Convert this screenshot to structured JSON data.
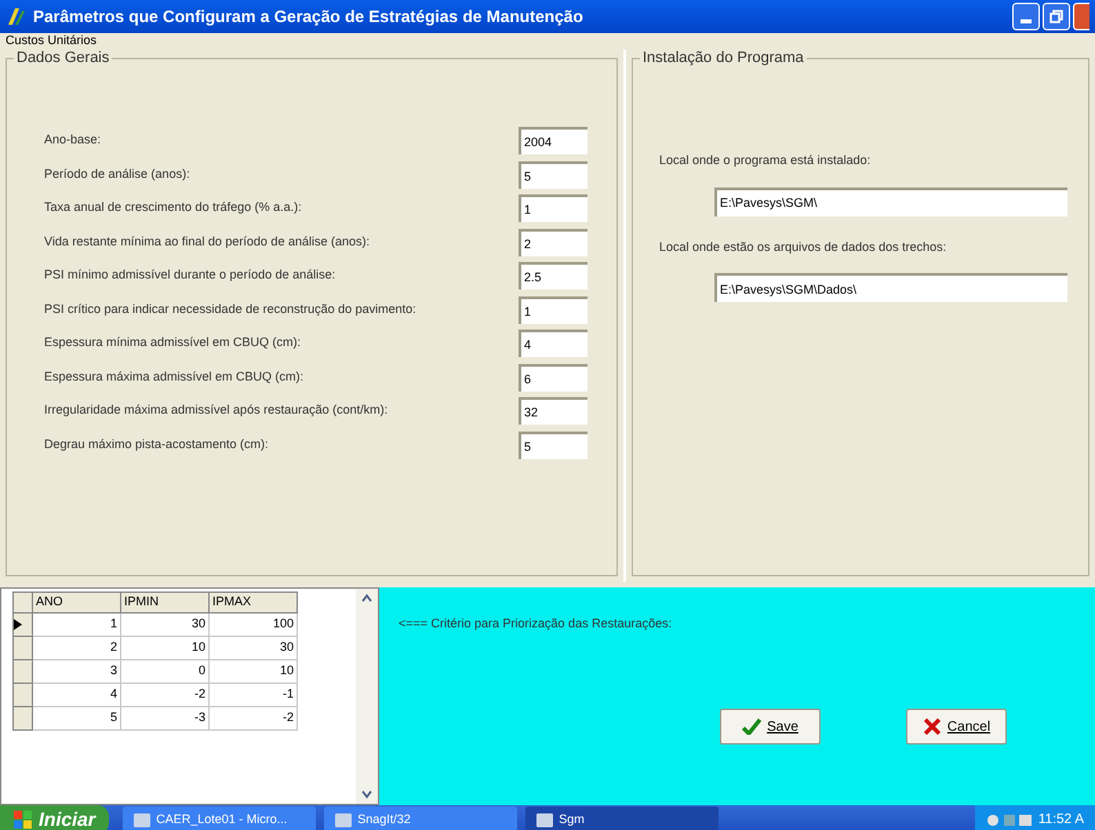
{
  "window": {
    "title": "Parâmetros que Configuram a Geração de Estratégias de Manutenção"
  },
  "menu": [
    "Custos Unitários"
  ],
  "general": {
    "title": "Dados Gerais",
    "fields": [
      {
        "label": "Ano-base:",
        "value": "2004"
      },
      {
        "label": "Período de análise (anos):",
        "value": "5"
      },
      {
        "label": "Taxa anual de crescimento do tráfego (% a.a.):",
        "value": "1"
      },
      {
        "label": "Vida restante mínima ao final do período de análise (anos):",
        "value": "2"
      },
      {
        "label": "PSI mínimo admissível durante o período de análise:",
        "value": "2.5"
      },
      {
        "label": "PSI crítico para indicar necessidade de reconstrução do pavimento:",
        "value": "1"
      },
      {
        "label": "Espessura mínima admissível em CBUQ (cm):",
        "value": "4"
      },
      {
        "label": "Espessura máxima admissível em CBUQ (cm):",
        "value": "6"
      },
      {
        "label": "Irregularidade máxima admissível após restauração (cont/km):",
        "value": "32"
      },
      {
        "label": "Degrau máximo pista-acostamento (cm):",
        "value": "5"
      }
    ]
  },
  "install": {
    "title": "Instalação do Programa",
    "fields": [
      {
        "label": "Local onde o programa está instalado:",
        "value": "E:\\Pavesys\\SGM\\"
      },
      {
        "label": "Local onde estão os arquivos de dados dos trechos:",
        "value": "E:\\Pavesys\\SGM\\Dados\\"
      }
    ]
  },
  "table": {
    "columns": [
      "ANO",
      "IPMIN",
      "IPMAX"
    ],
    "rows": [
      {
        "cells": [
          "1",
          "30",
          "100"
        ],
        "selected": true
      },
      {
        "cells": [
          "2",
          "10",
          "30"
        ],
        "selected": false
      },
      {
        "cells": [
          "3",
          "0",
          "10"
        ],
        "selected": false
      },
      {
        "cells": [
          "4",
          "-2",
          "-1"
        ],
        "selected": false
      },
      {
        "cells": [
          "5",
          "-3",
          "-2"
        ],
        "selected": false
      }
    ]
  },
  "criteria_note": "<=== Critério para Priorização das Restaurações:",
  "buttons": [
    {
      "kind": "save",
      "label": "Save"
    },
    {
      "kind": "cancel",
      "label": "Cancel"
    }
  ],
  "taskbar": {
    "start": "Iniciar",
    "tasks": [
      {
        "label": "CAER_Lote01 - Micro...",
        "selected": false
      },
      {
        "label": "SnagIt/32",
        "selected": false
      },
      {
        "label": "Sgm",
        "selected": true
      }
    ],
    "clock": "11:52 A"
  }
}
